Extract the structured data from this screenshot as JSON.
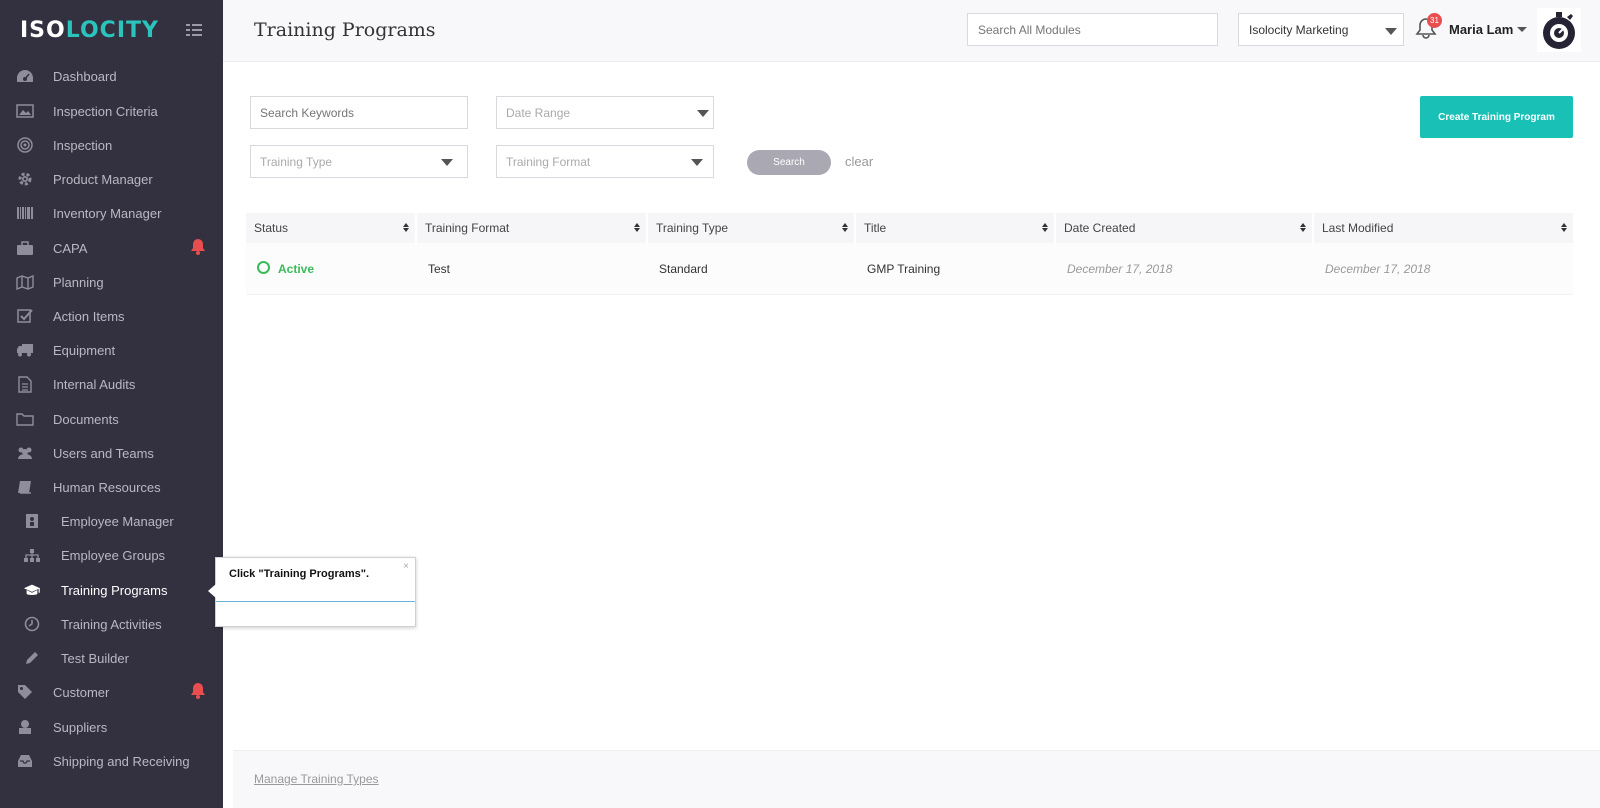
{
  "app": {
    "logo_iso": "ISO",
    "logo_locity": "LOCITY",
    "brand_accent": "#19c0b6"
  },
  "sidebar": {
    "items": [
      {
        "label": "Dashboard",
        "icon": "dashboard-icon"
      },
      {
        "label": "Inspection Criteria",
        "icon": "image-icon"
      },
      {
        "label": "Inspection",
        "icon": "target-icon"
      },
      {
        "label": "Product Manager",
        "icon": "gear-icon"
      },
      {
        "label": "Inventory Manager",
        "icon": "barcode-icon"
      },
      {
        "label": "CAPA",
        "icon": "briefcase-icon"
      },
      {
        "label": "Planning",
        "icon": "map-icon"
      },
      {
        "label": "Action Items",
        "icon": "checkbox-icon"
      },
      {
        "label": "Equipment",
        "icon": "truck-icon"
      },
      {
        "label": "Internal Audits",
        "icon": "document-icon"
      },
      {
        "label": "Documents",
        "icon": "folder-icon"
      },
      {
        "label": "Users and Teams",
        "icon": "users-icon"
      },
      {
        "label": "Human Resources",
        "icon": "book-icon"
      },
      {
        "label": "Employee Manager",
        "icon": "id-badge-icon"
      },
      {
        "label": "Employee Groups",
        "icon": "sitemap-icon"
      },
      {
        "label": "Training Programs",
        "icon": "graduation-cap-icon"
      },
      {
        "label": "Training Activities",
        "icon": "clock-icon"
      },
      {
        "label": "Test Builder",
        "icon": "pencil-icon"
      },
      {
        "label": "Customer",
        "icon": "tag-icon"
      },
      {
        "label": "Suppliers",
        "icon": "supplier-icon"
      },
      {
        "label": "Shipping and Receiving",
        "icon": "inbox-icon"
      }
    ]
  },
  "header": {
    "title": "Training Programs",
    "search_placeholder": "Search All Modules",
    "company": "Isolocity Marketing",
    "notification_count": "31",
    "user_name": "Maria Lam"
  },
  "filters": {
    "keywords_placeholder": "Search Keywords",
    "date_range": "Date Range",
    "training_type": "Training Type",
    "training_format": "Training Format",
    "search_label": "Search",
    "clear_label": "clear",
    "create_label": "Create Training Program"
  },
  "table": {
    "columns": [
      "Status",
      "Training Format",
      "Training Type",
      "Title",
      "Date Created",
      "Last Modified"
    ],
    "rows": [
      {
        "status": "Active",
        "format": "Test",
        "type": "Standard",
        "title": "GMP Training",
        "created": "December 17, 2018",
        "modified": "December 17, 2018"
      }
    ]
  },
  "footer": {
    "manage_link": "Manage Training Types"
  },
  "tooltip": {
    "text": "Click \"Training Programs\".",
    "close": "×"
  }
}
